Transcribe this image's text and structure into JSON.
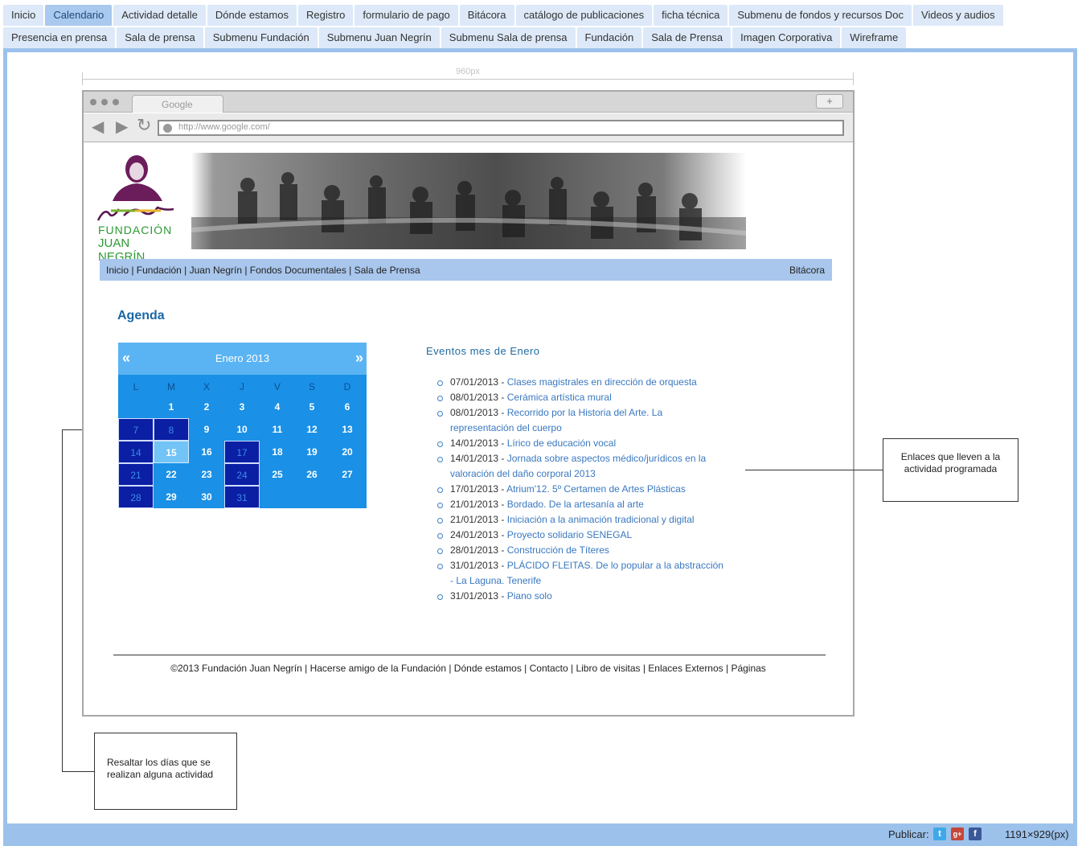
{
  "page_tabs_row1": [
    {
      "label": "Inicio",
      "active": false
    },
    {
      "label": "Calendario",
      "active": true
    },
    {
      "label": "Actividad detalle",
      "active": false
    },
    {
      "label": "Dónde estamos",
      "active": false
    },
    {
      "label": "Registro",
      "active": false
    },
    {
      "label": "formulario de pago",
      "active": false
    },
    {
      "label": "Bitácora",
      "active": false
    },
    {
      "label": "catálogo de publicaciones",
      "active": false
    },
    {
      "label": "ficha técnica",
      "active": false
    },
    {
      "label": "Submenu de fondos y recursos Doc",
      "active": false
    },
    {
      "label": "Videos y audios",
      "active": false
    }
  ],
  "page_tabs_row2": [
    {
      "label": "Presencia en prensa",
      "active": false
    },
    {
      "label": "Sala de prensa",
      "active": false
    },
    {
      "label": "Submenu Fundación",
      "active": false
    },
    {
      "label": "Submenu Juan Negrín",
      "active": false
    },
    {
      "label": "Submenu Sala de prensa",
      "active": false
    },
    {
      "label": "Fundación",
      "active": false
    },
    {
      "label": "Sala de Prensa",
      "active": false
    },
    {
      "label": "Imagen Corporativa",
      "active": false
    },
    {
      "label": "Wireframe",
      "active": false
    }
  ],
  "ruler": {
    "label": "960px"
  },
  "browser": {
    "tab_title": "Google",
    "new_tab": "+",
    "url": "http://www.google.com/"
  },
  "site": {
    "logo": {
      "line1": "FUNDACIÓN",
      "line2": "JUAN NEGRÍN"
    },
    "menu_left": "Inicio | Fundación | Juan Negrín | Fondos Documentales | Sala de Prensa",
    "menu_right": "Bitácora",
    "section_title": "Agenda",
    "calendar": {
      "prev": "«",
      "next": "»",
      "month_title": "Enero 2013",
      "weekdays": [
        "L",
        "M",
        "X",
        "J",
        "V",
        "S",
        "D"
      ],
      "first_weekday_index": 1,
      "days_in_month": 31,
      "event_days": [
        7,
        8,
        14,
        17,
        21,
        24,
        28,
        31
      ],
      "today": 15
    },
    "events_title": "Eventos mes de Enero",
    "events": [
      {
        "date": "07/01/2013 -",
        "title": "Clases magistrales en dirección de orquesta"
      },
      {
        "date": "08/01/2013 -",
        "title": "Cerámica artística mural"
      },
      {
        "date": "08/01/2013 -",
        "title": "Recorrido por la Historia del Arte. La representación del cuerpo"
      },
      {
        "date": "14/01/2013 -",
        "title": "Lírico de educación vocal"
      },
      {
        "date": "14/01/2013 -",
        "title": "Jornada sobre aspectos médico/jurídicos en la valoración del daño corporal 2013"
      },
      {
        "date": "17/01/2013 -",
        "title": "Atrium'12. 5º Certamen de Artes Plásticas"
      },
      {
        "date": "21/01/2013 -",
        "title": "Bordado. De la artesanía al arte"
      },
      {
        "date": "21/01/2013 -",
        "title": "Iniciación a la animación tradicional y digital"
      },
      {
        "date": "24/01/2013 -",
        "title": "Proyecto solidario SENEGAL"
      },
      {
        "date": "28/01/2013 -",
        "title": "Construcción de Títeres"
      },
      {
        "date": "31/01/2013 -",
        "title": "PLÁCIDO FLEITAS. De lo popular a la abstracción - La Laguna. Tenerife"
      },
      {
        "date": "31/01/2013 -",
        "title": "Piano solo"
      }
    ],
    "footer": "©2013 Fundación Juan Negrín | Hacerse amigo de la Fundación | Dónde estamos | Contacto | Libro de visitas | Enlaces Externos | Páginas"
  },
  "annotations": {
    "links_note": "Enlaces que lleven a la actividad programada",
    "highlight_note": "Resaltar los días que se realizan alguna actividad"
  },
  "statusbar": {
    "publish_label": "Publicar:",
    "dimensions": "1191×929(px)",
    "social_icons": [
      "twitter-icon",
      "google-plus-icon",
      "facebook-icon"
    ]
  },
  "colors": {
    "accent_blue": "#9cc2ec",
    "active_tab": "#a9c9ee",
    "calendar_bg": "#1a90e6",
    "calendar_event_day": "#0a1fa3",
    "link": "#3a78c0"
  }
}
